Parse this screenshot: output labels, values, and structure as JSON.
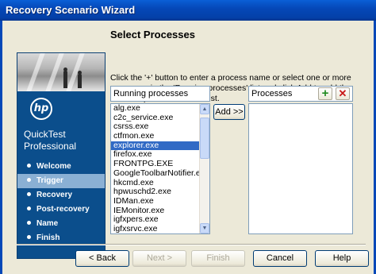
{
  "window": {
    "title": "Recovery Scenario Wizard"
  },
  "sidebar": {
    "product_name": "QuickTest Professional",
    "logo_text": "hp",
    "steps": [
      {
        "label": "Welcome"
      },
      {
        "label": "Trigger",
        "active": true
      },
      {
        "label": "Recovery"
      },
      {
        "label": "Post-recovery"
      },
      {
        "label": "Name"
      },
      {
        "label": "Finish"
      }
    ]
  },
  "main": {
    "heading": "Select Processes",
    "instructions": "Click the '+' button to enter a process name or select one or more processes in the 'Running processes' list and click Add to add the selected processes to the list.",
    "running_label": "Running processes",
    "processes_label": "Processes",
    "add_button": "Add >>",
    "running_processes": [
      "alg.exe",
      "c2c_service.exe",
      "csrss.exe",
      "ctfmon.exe",
      "explorer.exe",
      "firefox.exe",
      "FRONTPG.EXE",
      "GoogleToolbarNotifier.exe",
      "hkcmd.exe",
      "hpwuschd2.exe",
      "IDMan.exe",
      "IEMonitor.exe",
      "igfxpers.exe",
      "igfxsrvc.exe"
    ],
    "selected_process": "explorer.exe",
    "add_icon": "plus-icon",
    "remove_icon": "delete-x-icon"
  },
  "footer": {
    "back": "< Back",
    "next": "Next >",
    "finish": "Finish",
    "cancel": "Cancel",
    "help": "Help"
  },
  "colors": {
    "titlebar": "#0548b8",
    "sidebar": "#0b4e8c",
    "active_step": "#8ab0d4",
    "selection": "#316ac5",
    "add_green": "#1f8a1f",
    "remove_red": "#c81818"
  }
}
